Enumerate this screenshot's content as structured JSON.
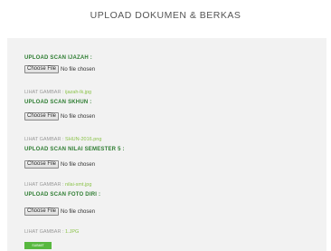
{
  "header": {
    "title": "UPLOAD DOKUMEN & BERKAS"
  },
  "sections": [
    {
      "title": "UPLOAD SCAN IJAZAH :",
      "button_label": "Choose File",
      "status": "No file chosen",
      "view_label": "LIHAT GAMBAR",
      "view_sep": " : ",
      "filename": "ijazah-lk.jpg"
    },
    {
      "title": "UPLOAD SCAN SKHUN :",
      "button_label": "Choose File",
      "status": "No file chosen",
      "view_label": "LIHAT GAMBAR",
      "view_sep": " : ",
      "filename": "SHUN-2016.png"
    },
    {
      "title": "UPLOAD SCAN NILAI SEMESTER 5 :",
      "button_label": "Choose File",
      "status": "No file chosen",
      "view_label": "LIHAT GAMBAR",
      "view_sep": " : ",
      "filename": "nilai-smt.jpg"
    },
    {
      "title": "UPLOAD SCAN FOTO DIRI :",
      "button_label": "Choose File",
      "status": "No file chosen",
      "view_label": "LIHAT GAMBAR",
      "view_sep": " : ",
      "filename": "1.JPG"
    }
  ],
  "submit_label": "SUBMIT",
  "colors": {
    "panel_bg": "#f2f2f2",
    "section_title": "#2e7d32",
    "file_link": "#8bc34a",
    "submit_bg": "#58b83f"
  }
}
